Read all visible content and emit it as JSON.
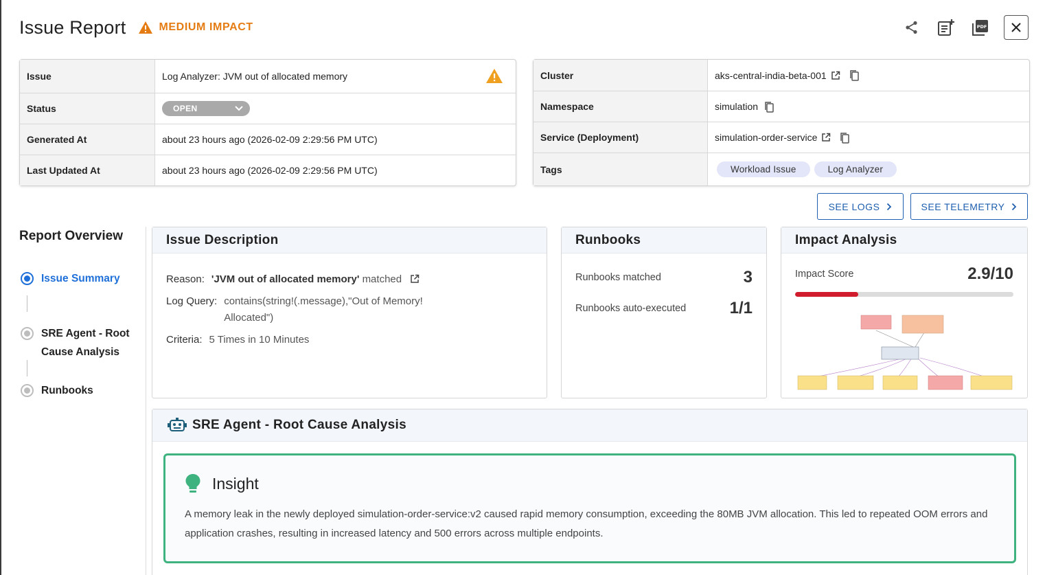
{
  "header": {
    "title": "Issue Report",
    "impact_label": "MEDIUM IMPACT",
    "impact_color": "#e57c13"
  },
  "issue_table": {
    "rows": [
      {
        "key": "Issue",
        "value": "Log Analyzer: JVM out of allocated memory"
      },
      {
        "key": "Status",
        "value": "OPEN"
      },
      {
        "key": "Generated At",
        "value": "about 23 hours ago (2026-02-09 2:29:56 PM UTC)"
      },
      {
        "key": "Last Updated At",
        "value": "about 23 hours ago (2026-02-09 2:29:56 PM UTC)"
      }
    ]
  },
  "resource_table": {
    "rows": [
      {
        "key": "Cluster",
        "value": "aks-central-india-beta-001"
      },
      {
        "key": "Namespace",
        "value": "simulation"
      },
      {
        "key": "Service (Deployment)",
        "value": "simulation-order-service"
      },
      {
        "key": "Tags",
        "value": ""
      }
    ],
    "tags": [
      "Workload Issue",
      "Log Analyzer"
    ]
  },
  "actions": {
    "see_logs": "SEE LOGS",
    "see_telemetry": "SEE TELEMETRY"
  },
  "overview": {
    "title": "Report Overview",
    "steps": [
      {
        "label": "Issue Summary",
        "active": true
      },
      {
        "label": "SRE Agent - Root Cause Analysis",
        "active": false
      },
      {
        "label": "Runbooks",
        "active": false
      }
    ]
  },
  "description": {
    "title": "Issue Description",
    "reason_key": "Reason:",
    "reason_quote": "'JVM out of allocated memory'",
    "reason_suffix": "matched",
    "query_key": "Log Query:",
    "query_value": "contains(string!(.message),\"Out of Memory! Allocated\")",
    "criteria_key": "Criteria:",
    "criteria_value": "5 Times in 10 Minutes"
  },
  "runbooks": {
    "title": "Runbooks",
    "matched_label": "Runbooks matched",
    "matched_value": "3",
    "auto_label": "Runbooks auto-executed",
    "auto_value": "1/1"
  },
  "impact": {
    "title": "Impact Analysis",
    "score_label": "Impact Score",
    "score_value": "2.9/10",
    "score_fraction": 0.29,
    "bar_color": "#d01c2c"
  },
  "rca": {
    "title": "SRE Agent - Root Cause Analysis",
    "insight_title": "Insight",
    "insight_text": "A memory leak in the newly deployed simulation-order-service:v2 caused rapid memory consumption, exceeding the 80MB JVM allocation. This led to repeated OOM errors and application crashes, resulting in increased latency and 500 errors across multiple endpoints.",
    "border_color": "#3fb37f"
  }
}
